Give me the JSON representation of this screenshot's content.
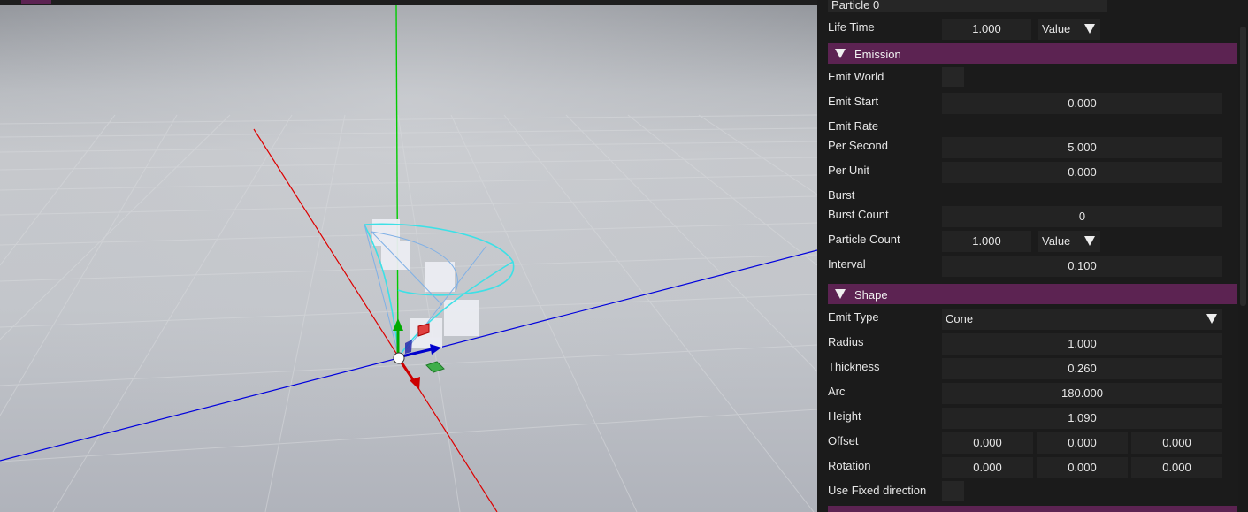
{
  "particle_name": "Particle 0",
  "life_time": {
    "label": "Life Time",
    "value": "1.000",
    "mode": "Value"
  },
  "emission": {
    "title": "Emission",
    "emit_world": {
      "label": "Emit World"
    },
    "emit_start": {
      "label": "Emit Start",
      "value": "0.000"
    },
    "emit_rate": {
      "label": "Emit Rate"
    },
    "per_second": {
      "label": "Per Second",
      "value": "5.000"
    },
    "per_unit": {
      "label": "Per Unit",
      "value": "0.000"
    },
    "burst": {
      "label": "Burst"
    },
    "burst_count": {
      "label": "Burst Count",
      "value": "0"
    },
    "particle_count": {
      "label": "Particle Count",
      "value": "1.000",
      "mode": "Value"
    },
    "interval": {
      "label": "Interval",
      "value": "0.100"
    }
  },
  "shape": {
    "title": "Shape",
    "emit_type": {
      "label": "Emit Type",
      "value": "Cone"
    },
    "radius": {
      "label": "Radius",
      "value": "1.000"
    },
    "thickness": {
      "label": "Thickness",
      "value": "0.260"
    },
    "arc": {
      "label": "Arc",
      "value": "180.000"
    },
    "height": {
      "label": "Height",
      "value": "1.090"
    },
    "offset": {
      "label": "Offset",
      "x": "0.000",
      "y": "0.000",
      "z": "0.000"
    },
    "rotation": {
      "label": "Rotation",
      "x": "0.000",
      "y": "0.000",
      "z": "0.000"
    },
    "use_fixed_direction": {
      "label": "Use Fixed direction"
    }
  },
  "colors": {
    "section_header": "#5c2352",
    "field_bg": "#232323",
    "panel_bg": "#1b1b1b",
    "axis_x": "#dd0000",
    "axis_y": "#00cc00",
    "axis_z": "#0000dd",
    "cone_gizmo": "#3de0e6"
  }
}
